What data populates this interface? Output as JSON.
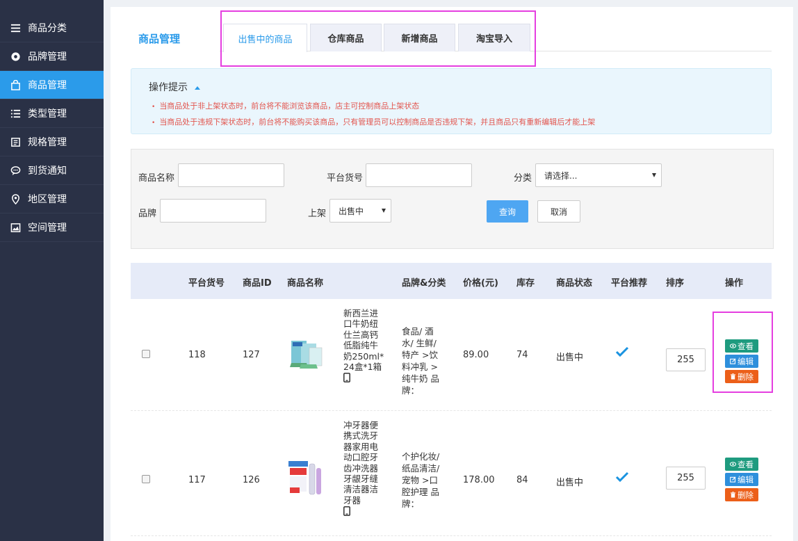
{
  "sidebar": {
    "items": [
      {
        "label": "商品分类",
        "icon": "list-icon",
        "active": false
      },
      {
        "label": "品牌管理",
        "icon": "brand-icon",
        "active": false
      },
      {
        "label": "商品管理",
        "icon": "bag-icon",
        "active": true
      },
      {
        "label": "类型管理",
        "icon": "list-bullets-icon",
        "active": false
      },
      {
        "label": "规格管理",
        "icon": "document-icon",
        "active": false
      },
      {
        "label": "到货通知",
        "icon": "chat-icon",
        "active": false
      },
      {
        "label": "地区管理",
        "icon": "location-pin-icon",
        "active": false
      },
      {
        "label": "空间管理",
        "icon": "image-icon",
        "active": false
      }
    ]
  },
  "header": {
    "title": "商品管理",
    "tabs": [
      {
        "label": "出售中的商品",
        "active": true
      },
      {
        "label": "仓库商品",
        "active": false
      },
      {
        "label": "新增商品",
        "active": false
      },
      {
        "label": "淘宝导入",
        "active": false
      }
    ]
  },
  "tips": {
    "title": "操作提示",
    "items": [
      "当商品处于非上架状态时，前台将不能浏览该商品，店主可控制商品上架状态",
      "当商品处于违规下架状态时，前台将不能购买该商品，只有管理员可以控制商品是否违规下架，并且商品只有重新编辑后才能上架"
    ]
  },
  "filter": {
    "name_label": "商品名称",
    "sku_label": "平台货号",
    "category_label": "分类",
    "category_value": "请选择...",
    "brand_label": "品牌",
    "shelf_label": "上架",
    "shelf_value": "出售中",
    "query_label": "查询",
    "cancel_label": "取消"
  },
  "table": {
    "headers": {
      "sku": "平台货号",
      "id": "商品ID",
      "name": "商品名称",
      "brand": "品牌&分类",
      "price": "价格(元)",
      "stock": "库存",
      "status": "商品状态",
      "recommend": "平台推荐",
      "sort": "排序",
      "ops": "操作"
    },
    "rows": [
      {
        "sku": "118",
        "id": "127",
        "name": "新西兰进口牛奶纽仕兰高钙低脂纯牛奶250ml*24盒*1箱",
        "brand": "食品/ 酒水/ 生鲜/ 特产 >饮料冲乳 > 纯牛奶 品牌：",
        "price": "89.00",
        "stock": "74",
        "status": "出售中",
        "sort": "255"
      },
      {
        "sku": "117",
        "id": "126",
        "name": "冲牙器便携式洗牙器家用电动口腔牙齿冲洗器牙龈牙缝清洁器洁牙器",
        "brand": "个护化妆/ 纸品清洁/ 宠物 >口腔护理 品牌：",
        "price": "178.00",
        "stock": "84",
        "status": "出售中",
        "sort": "255"
      }
    ],
    "ops": {
      "view": "查看",
      "edit": "编辑",
      "del": "删除"
    }
  },
  "colors": {
    "sidebar_bg": "#2a3146",
    "accent": "#2b9bea",
    "highlight": "#e53ee0",
    "view_btn": "#1e9b7f",
    "edit_btn": "#2e8fdc",
    "del_btn": "#ec5f19"
  }
}
